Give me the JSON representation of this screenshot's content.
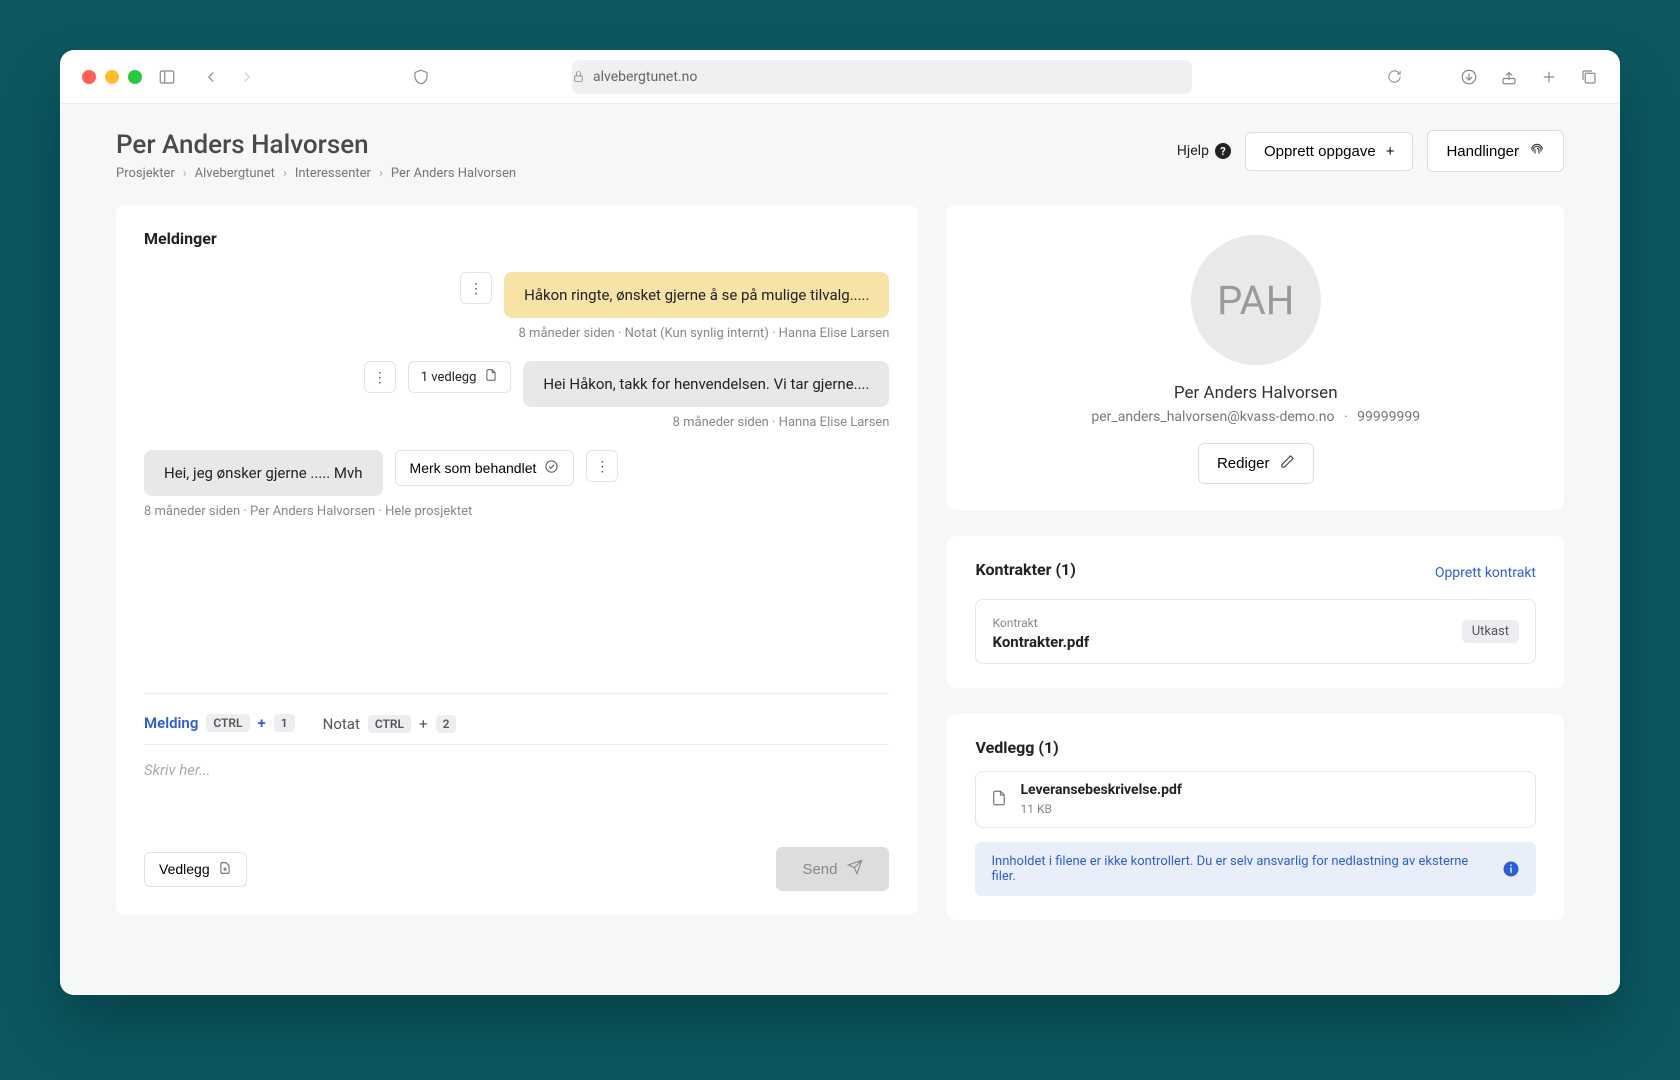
{
  "browser": {
    "url": "alvebergtunet.no"
  },
  "header": {
    "title": "Per Anders Halvorsen",
    "breadcrumb": [
      "Prosjekter",
      "Alvebergtunet",
      "Interessenter",
      "Per Anders Halvorsen"
    ],
    "help_label": "Hjelp",
    "create_task_label": "Opprett oppgave",
    "actions_label": "Handlinger"
  },
  "messages": {
    "title": "Meldinger",
    "items": [
      {
        "side": "right",
        "kind": "note",
        "text": "Håkon ringte, ønsket gjerne å se på mulige tilvalg.....",
        "meta": "8 måneder siden  ·  Notat (Kun synlig internt)  ·  Hanna Elise Larsen"
      },
      {
        "side": "right",
        "kind": "out",
        "attachment_label": "1 vedlegg",
        "text": "Hei Håkon, takk for henvendelsen. Vi tar gjerne....",
        "meta": "8 måneder siden  ·  Hanna Elise Larsen"
      },
      {
        "side": "left",
        "kind": "in",
        "text": "Hei, jeg ønsker gjerne ..... Mvh",
        "action_label": "Merk som behandlet",
        "meta": "8 måneder siden  ·  Per Anders Halvorsen  ·  Hele prosjektet"
      }
    ],
    "composer": {
      "tab_message": "Melding",
      "tab_note": "Notat",
      "kbd_ctrl": "CTRL",
      "kbd_plus": "+",
      "kbd_1": "1",
      "kbd_2": "2",
      "placeholder": "Skriv her...",
      "attach_label": "Vedlegg",
      "send_label": "Send"
    }
  },
  "profile": {
    "initials": "PAH",
    "name": "Per Anders Halvorsen",
    "email": "per_anders_halvorsen@kvass-demo.no",
    "phone": "99999999",
    "edit_label": "Rediger"
  },
  "contracts": {
    "title": "Kontrakter (1)",
    "create_label": "Opprett kontrakt",
    "items": [
      {
        "type_label": "Kontrakt",
        "filename": "Kontrakter.pdf",
        "status": "Utkast"
      }
    ]
  },
  "attachments": {
    "title": "Vedlegg (1)",
    "items": [
      {
        "filename": "Leveransebeskrivelse.pdf",
        "size": "11 KB"
      }
    ],
    "info": "Innholdet i filene er ikke kontrollert. Du er selv ansvarlig for nedlastning av eksterne filer."
  }
}
